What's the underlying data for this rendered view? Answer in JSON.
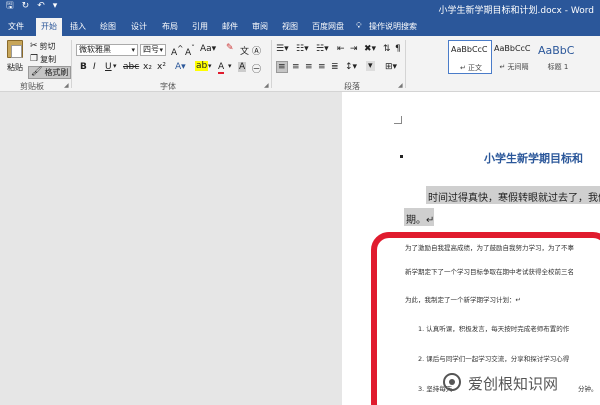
{
  "titlebar": {
    "doc_title": "小学生新学期目标和计划.docx - Word",
    "save_icon": "save-icon",
    "undo_icon": "undo-icon",
    "redo_icon": "redo-icon"
  },
  "tabs": [
    "文件",
    "开始",
    "插入",
    "绘图",
    "设计",
    "布局",
    "引用",
    "邮件",
    "审阅",
    "视图",
    "百度网盘"
  ],
  "tell_me": "操作说明搜索",
  "ribbon": {
    "clipboard": {
      "paste": "粘贴",
      "cut": "剪切",
      "copy": "复制",
      "format_painter": "格式刷",
      "group_label": "剪贴板"
    },
    "font": {
      "font_name": "微软雅黑",
      "font_size": "四号",
      "group_label": "字体"
    },
    "paragraph": {
      "group_label": "段落"
    },
    "styles": {
      "items": [
        {
          "sample": "AaBbCcC",
          "name": "↵ 正文"
        },
        {
          "sample": "AaBbCcC",
          "name": "↵ 无间隔"
        },
        {
          "sample": "AaBbC",
          "name": "标题 1"
        }
      ]
    }
  },
  "document": {
    "heading": "小学生新学期目标和",
    "para1": "时间过得真快，寒假转眼就过去了，我们",
    "para1_end": "期。↵",
    "inner_lines": [
      "为了激励自我提高成绩，为了鼓励自我努力学习，为了不辜",
      "新学期定下了一个学习目标争取在期中考试获得全校前三名",
      "为此，我制定了一个新学期学习计划：↵",
      "1.    认真听课，积极发言，每天按时完成老师布置的作",
      "2.    课后与同学们一起学习交流，分享和探讨学习心得",
      "3.    坚持每天"
    ],
    "inner_line3_tail": "分钟。"
  },
  "watermark": "爱创根知识网",
  "colors": {
    "accent": "#2b579a",
    "frame": "#e01b2e"
  }
}
